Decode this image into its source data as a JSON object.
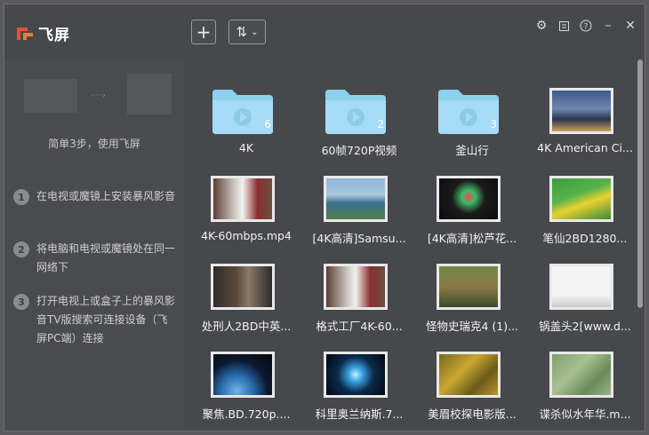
{
  "app": {
    "title": "飞屏"
  },
  "toolbar": {
    "add_label": "+",
    "sort_label": "⇅"
  },
  "sidebar": {
    "tagline": "简单3步，使用飞屏",
    "steps": [
      {
        "num": "1",
        "text": "在电视或魔镜上安装暴风影音"
      },
      {
        "num": "2",
        "text": "将电脑和电视或魔镜处在同一网络下"
      },
      {
        "num": "3",
        "text": "打开电视上或盒子上的暴风影音TV版搜索可连接设备（飞屏PC端）连接"
      }
    ]
  },
  "items": [
    {
      "name": "4K",
      "kind": "folder",
      "count": "6"
    },
    {
      "name": "60帧720P视频",
      "kind": "folder",
      "count": "2"
    },
    {
      "name": "釜山行",
      "kind": "folder",
      "count": "3"
    },
    {
      "name": "4K American Ci...",
      "kind": "video",
      "thumb": "city"
    },
    {
      "name": "4K-60mbps.mp4",
      "kind": "video",
      "thumb": "chef"
    },
    {
      "name": "[4K高清]Samsu...",
      "kind": "video",
      "thumb": "harbor"
    },
    {
      "name": "[4K高清]松芦花...",
      "kind": "video",
      "thumb": "fireworks"
    },
    {
      "name": "笔仙2BD1280...",
      "kind": "video",
      "thumb": "banana"
    },
    {
      "name": "处刑人2BD中英...",
      "kind": "video",
      "thumb": "movie"
    },
    {
      "name": "格式工厂4K-60...",
      "kind": "video",
      "thumb": "chef"
    },
    {
      "name": "怪物史瑞克4 (1)...",
      "kind": "video",
      "thumb": "shrek"
    },
    {
      "name": "锅盖头2[www.d...",
      "kind": "video",
      "thumb": "web"
    },
    {
      "name": "聚焦.BD.720p....",
      "kind": "video",
      "thumb": "earth"
    },
    {
      "name": "科里奥兰纳斯.7...",
      "kind": "video",
      "thumb": "glow"
    },
    {
      "name": "美眉校探电影版...",
      "kind": "video",
      "thumb": "gold"
    },
    {
      "name": "谍杀似水年华.m...",
      "kind": "video",
      "thumb": "map"
    }
  ]
}
